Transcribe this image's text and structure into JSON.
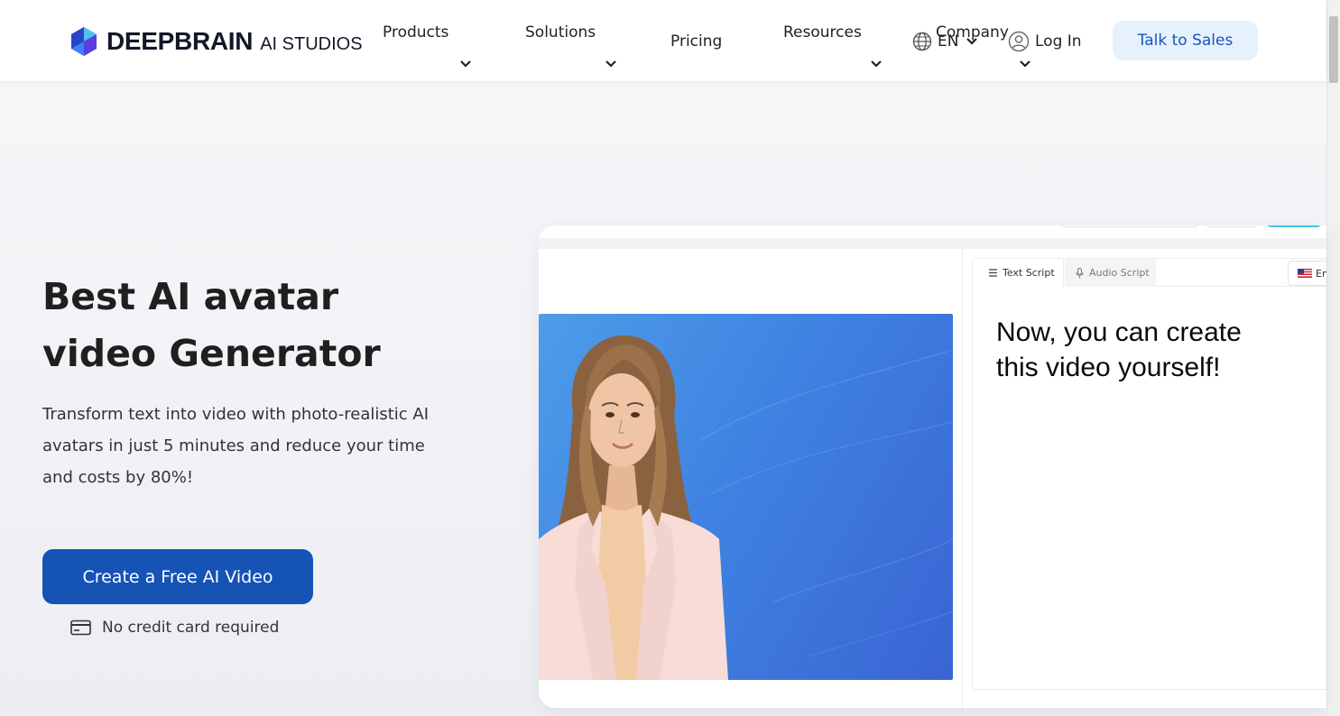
{
  "header": {
    "logo": {
      "brand": "DEEPBRAIN",
      "sub": "AI STUDIOS"
    },
    "nav": [
      {
        "label": "Products",
        "has_dropdown": true
      },
      {
        "label": "Solutions",
        "has_dropdown": true
      },
      {
        "label": "Pricing",
        "has_dropdown": false
      },
      {
        "label": "Resources",
        "has_dropdown": true
      },
      {
        "label": "Company",
        "has_dropdown": true
      }
    ],
    "language": "EN",
    "login_label": "Log In",
    "cta_label": "Talk to Sales"
  },
  "hero": {
    "title_lines": [
      "Best AI avatar",
      "video Generator"
    ],
    "description_lines": [
      "Transform text into video with photo-realistic AI",
      "avatars in just 5 minutes and reduce your time",
      "and costs by 80%!"
    ],
    "cta_label": "Create a Free AI Video",
    "note": "No credit card required"
  },
  "preview": {
    "tabs": [
      {
        "label": "Text Script",
        "icon": "list-icon",
        "active": true
      },
      {
        "label": "Audio Script",
        "icon": "microphone-icon",
        "active": false
      }
    ],
    "language_chip": "En",
    "script_lines": [
      "Now, you can create",
      "this video yourself!"
    ]
  },
  "colors": {
    "primary": "#1553b5",
    "talk_bg": "#e6f1fc",
    "talk_text": "#1556c0",
    "video_bg": "#3f83e2"
  }
}
